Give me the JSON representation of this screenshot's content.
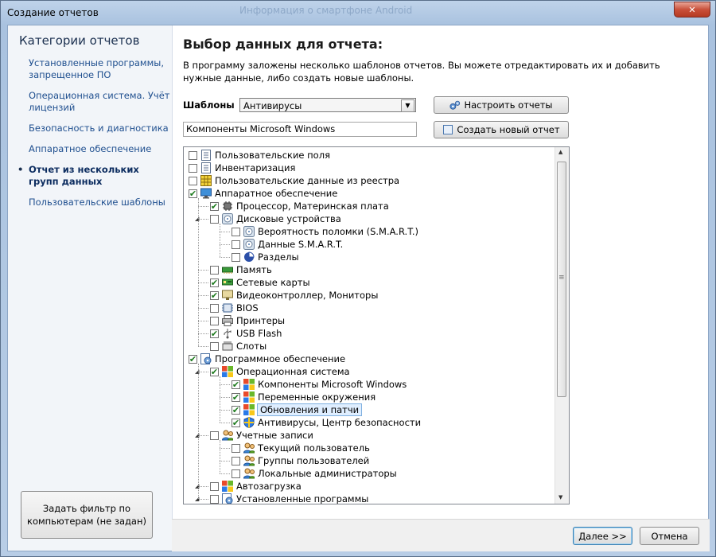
{
  "window": {
    "title": "Создание отчетов",
    "background_title": "Информация о смартфоне Android",
    "close_label": "✕"
  },
  "sidebar": {
    "title": "Категории отчетов",
    "items": [
      {
        "label": "Установленные программы, запрещенное ПО",
        "active": false
      },
      {
        "label": "Операционная система. Учёт лицензий",
        "active": false
      },
      {
        "label": "Безопасность и диагностика",
        "active": false
      },
      {
        "label": "Аппаратное обеспечение",
        "active": false
      },
      {
        "label": "Отчет из нескольких групп данных",
        "active": true
      },
      {
        "label": "Пользовательские шаблоны",
        "active": false
      }
    ],
    "bullet": "•",
    "filter_button": "Задать фильтр по компьютерам (не задан)"
  },
  "main": {
    "title": "Выбор данных для отчета:",
    "description": "В программу заложены несколько шаблонов отчетов. Вы можете отредактировать их и добавить нужные данные, либо создать новые шаблоны.",
    "templates_label": "Шаблоны",
    "templates_value": "Антивирусы",
    "name_value": "Компоненты Microsoft Windows",
    "configure_button": "Настроить отчеты",
    "new_report_button": "Создать новый отчет"
  },
  "tree": {
    "items": [
      {
        "label": "Пользовательские поля",
        "checked": false,
        "icon": "list-icon"
      },
      {
        "label": "Инвентаризация",
        "checked": false,
        "icon": "list-icon"
      },
      {
        "label": "Пользовательские данные из реестра",
        "checked": false,
        "icon": "registry-grid-icon"
      },
      {
        "label": "Аппаратное обеспечение",
        "checked": true,
        "icon": "monitor-icon"
      },
      {
        "label": "Процессор, Материнская плата",
        "checked": true,
        "icon": "cpu-icon"
      },
      {
        "label": "Дисковые устройства",
        "checked": false,
        "icon": "disk-icon"
      },
      {
        "label": "Вероятность поломки (S.M.A.R.T.)",
        "checked": false,
        "icon": "disk-icon"
      },
      {
        "label": "Данные S.M.A.R.T.",
        "checked": false,
        "icon": "disk-icon"
      },
      {
        "label": "Разделы",
        "checked": false,
        "icon": "pie-chart-icon"
      },
      {
        "label": "Память",
        "checked": false,
        "icon": "memory-icon"
      },
      {
        "label": "Сетевые карты",
        "checked": true,
        "icon": "network-card-icon"
      },
      {
        "label": "Видеоконтроллер, Мониторы",
        "checked": true,
        "icon": "display-icon"
      },
      {
        "label": "BIOS",
        "checked": false,
        "icon": "bios-chip-icon"
      },
      {
        "label": "Принтеры",
        "checked": false,
        "icon": "printer-icon"
      },
      {
        "label": "USB Flash",
        "checked": true,
        "icon": "usb-icon"
      },
      {
        "label": "Слоты",
        "checked": false,
        "icon": "slot-icon"
      },
      {
        "label": "Программное обеспечение",
        "checked": true,
        "icon": "software-icon"
      },
      {
        "label": "Операционная система",
        "checked": true,
        "icon": "windows-logo-icon"
      },
      {
        "label": "Компоненты Microsoft Windows",
        "checked": true,
        "icon": "windows-logo-icon"
      },
      {
        "label": "Переменные окружения",
        "checked": true,
        "icon": "windows-logo-icon"
      },
      {
        "label": "Обновления и патчи",
        "checked": true,
        "icon": "windows-logo-icon",
        "selected": true
      },
      {
        "label": "Антивирусы, Центр безопасности",
        "checked": true,
        "icon": "security-shield-icon"
      },
      {
        "label": "Учетные записи",
        "checked": false,
        "icon": "users-icon"
      },
      {
        "label": "Текущий пользователь",
        "checked": false,
        "icon": "users-icon"
      },
      {
        "label": "Группы пользователей",
        "checked": false,
        "icon": "users-icon"
      },
      {
        "label": "Локальные администраторы",
        "checked": false,
        "icon": "users-icon"
      },
      {
        "label": "Автозагрузка",
        "checked": false,
        "icon": "windows-logo-icon"
      },
      {
        "label": "Установленные программы",
        "checked": false,
        "icon": "software-icon"
      }
    ],
    "check_glyph": "✔",
    "expander_glyph": "◢",
    "scroll_grip": "≡",
    "scroll_up": "▲",
    "scroll_down": "▼"
  },
  "footer": {
    "next_button": "Далее >>",
    "cancel_button": "Отмена"
  },
  "colors": {
    "link": "#1f4f8f",
    "check": "#1c7a1c",
    "selection": "#dfeeff"
  }
}
